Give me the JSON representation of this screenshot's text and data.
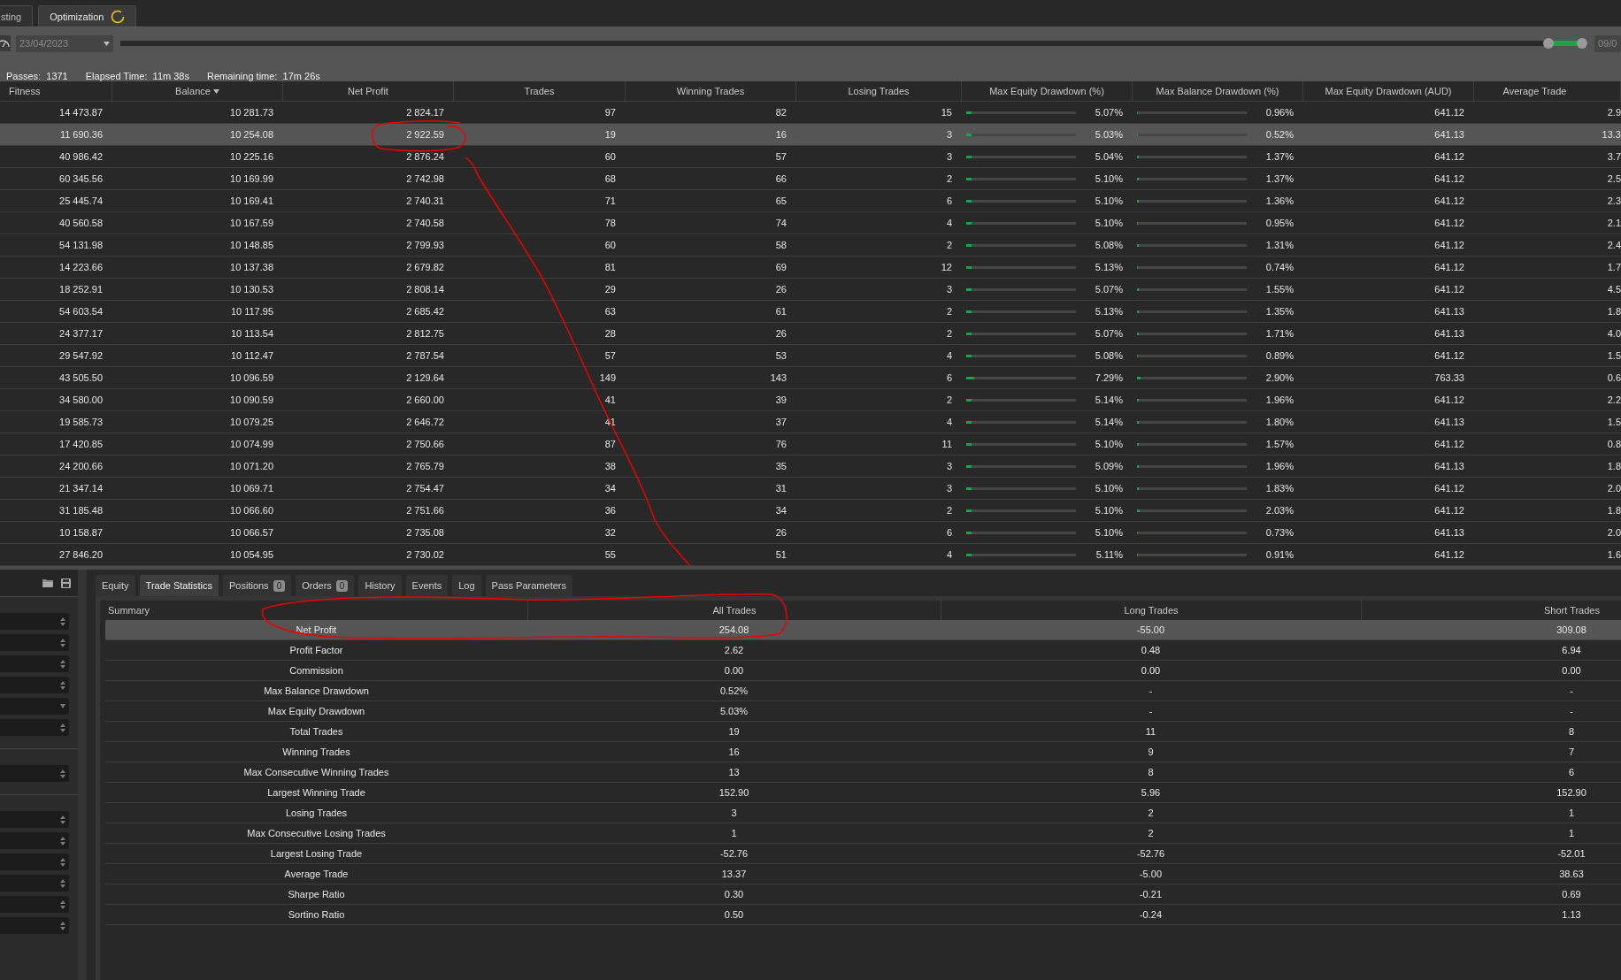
{
  "tabs": [
    {
      "label": "sting",
      "selected": false,
      "spinner": false
    },
    {
      "label": "Optimization",
      "selected": true,
      "spinner": true
    }
  ],
  "toolbar": {
    "start_date": "23/04/2023",
    "end_date": "09/0",
    "range": {
      "from": {
        "level": 0.977
      },
      "to": {
        "level": 1.0
      }
    }
  },
  "status": [
    {
      "label": "Passes:",
      "value": "1371"
    },
    {
      "label": "Elapsed Time:",
      "value": "11m 38s"
    },
    {
      "label": "Remaining time:",
      "value": "17m 26s"
    }
  ],
  "results": {
    "columns": [
      {
        "label": "Fitness",
        "kind": "text",
        "sorted": false
      },
      {
        "label": "Balance",
        "kind": "text",
        "sorted": true
      },
      {
        "label": "Net Profit",
        "kind": "text",
        "sorted": false
      },
      {
        "label": "Trades",
        "kind": "text",
        "sorted": false
      },
      {
        "label": "Winning Trades",
        "kind": "text",
        "sorted": false
      },
      {
        "label": "Losing Trades",
        "kind": "text",
        "sorted": false
      },
      {
        "label": "Max Equity Drawdown (%)",
        "kind": "bar",
        "sorted": false
      },
      {
        "label": "Max Balance Drawdown (%)",
        "kind": "bar",
        "sorted": false
      },
      {
        "label": "Max Equity Drawdown (AUD)",
        "kind": "text",
        "sorted": false
      },
      {
        "label": "Average Trade",
        "kind": "text",
        "sorted": false
      }
    ],
    "rows": [
      {
        "selected": false,
        "cells": [
          {
            "text": "14 473.87"
          },
          {
            "text": "10 281.73"
          },
          {
            "text": "2 824.17"
          },
          {
            "text": "97"
          },
          {
            "text": "82"
          },
          {
            "text": "15"
          },
          {
            "text": "5.07%",
            "level": 0.0507
          },
          {
            "text": "0.96%",
            "level": 0.0096
          },
          {
            "text": "641.12"
          },
          {
            "text": "2.9"
          }
        ]
      },
      {
        "selected": true,
        "cells": [
          {
            "text": "11 690.36"
          },
          {
            "text": "10 254.08"
          },
          {
            "text": "2 922.59"
          },
          {
            "text": "19"
          },
          {
            "text": "16"
          },
          {
            "text": "3"
          },
          {
            "text": "5.03%",
            "level": 0.0503
          },
          {
            "text": "0.52%",
            "level": 0.0052
          },
          {
            "text": "641.13"
          },
          {
            "text": "13.3"
          }
        ]
      },
      {
        "selected": false,
        "cells": [
          {
            "text": "40 986.42"
          },
          {
            "text": "10 225.16"
          },
          {
            "text": "2 876.24"
          },
          {
            "text": "60"
          },
          {
            "text": "57"
          },
          {
            "text": "3"
          },
          {
            "text": "5.04%",
            "level": 0.0504
          },
          {
            "text": "1.37%",
            "level": 0.0137
          },
          {
            "text": "641.12"
          },
          {
            "text": "3.7"
          }
        ]
      },
      {
        "selected": false,
        "cells": [
          {
            "text": "60 345.56"
          },
          {
            "text": "10 169.99"
          },
          {
            "text": "2 742.98"
          },
          {
            "text": "68"
          },
          {
            "text": "66"
          },
          {
            "text": "2"
          },
          {
            "text": "5.10%",
            "level": 0.051
          },
          {
            "text": "1.37%",
            "level": 0.0137
          },
          {
            "text": "641.12"
          },
          {
            "text": "2.5"
          }
        ]
      },
      {
        "selected": false,
        "cells": [
          {
            "text": "25 445.74"
          },
          {
            "text": "10 169.41"
          },
          {
            "text": "2 740.31"
          },
          {
            "text": "71"
          },
          {
            "text": "65"
          },
          {
            "text": "6"
          },
          {
            "text": "5.10%",
            "level": 0.051
          },
          {
            "text": "1.36%",
            "level": 0.0136
          },
          {
            "text": "641.12"
          },
          {
            "text": "2.3"
          }
        ]
      },
      {
        "selected": false,
        "cells": [
          {
            "text": "40 560.58"
          },
          {
            "text": "10 167.59"
          },
          {
            "text": "2 740.58"
          },
          {
            "text": "78"
          },
          {
            "text": "74"
          },
          {
            "text": "4"
          },
          {
            "text": "5.10%",
            "level": 0.051
          },
          {
            "text": "0.95%",
            "level": 0.0095
          },
          {
            "text": "641.12"
          },
          {
            "text": "2.1"
          }
        ]
      },
      {
        "selected": false,
        "cells": [
          {
            "text": "54 131.98"
          },
          {
            "text": "10 148.85"
          },
          {
            "text": "2 799.93"
          },
          {
            "text": "60"
          },
          {
            "text": "58"
          },
          {
            "text": "2"
          },
          {
            "text": "5.08%",
            "level": 0.0508
          },
          {
            "text": "1.31%",
            "level": 0.0131
          },
          {
            "text": "641.12"
          },
          {
            "text": "2.4"
          }
        ]
      },
      {
        "selected": false,
        "cells": [
          {
            "text": "14 223.66"
          },
          {
            "text": "10 137.38"
          },
          {
            "text": "2 679.82"
          },
          {
            "text": "81"
          },
          {
            "text": "69"
          },
          {
            "text": "12"
          },
          {
            "text": "5.13%",
            "level": 0.0513
          },
          {
            "text": "0.74%",
            "level": 0.0074
          },
          {
            "text": "641.12"
          },
          {
            "text": "1.7"
          }
        ]
      },
      {
        "selected": false,
        "cells": [
          {
            "text": "18 252.91"
          },
          {
            "text": "10 130.53"
          },
          {
            "text": "2 808.14"
          },
          {
            "text": "29"
          },
          {
            "text": "26"
          },
          {
            "text": "3"
          },
          {
            "text": "5.07%",
            "level": 0.0507
          },
          {
            "text": "1.55%",
            "level": 0.0155
          },
          {
            "text": "641.12"
          },
          {
            "text": "4.5"
          }
        ]
      },
      {
        "selected": false,
        "cells": [
          {
            "text": "54 603.54"
          },
          {
            "text": "10 117.95"
          },
          {
            "text": "2 685.42"
          },
          {
            "text": "63"
          },
          {
            "text": "61"
          },
          {
            "text": "2"
          },
          {
            "text": "5.13%",
            "level": 0.0513
          },
          {
            "text": "1.35%",
            "level": 0.0135
          },
          {
            "text": "641.13"
          },
          {
            "text": "1.8"
          }
        ]
      },
      {
        "selected": false,
        "cells": [
          {
            "text": "24 377.17"
          },
          {
            "text": "10 113.54"
          },
          {
            "text": "2 812.75"
          },
          {
            "text": "28"
          },
          {
            "text": "26"
          },
          {
            "text": "2"
          },
          {
            "text": "5.07%",
            "level": 0.0507
          },
          {
            "text": "1.71%",
            "level": 0.0171
          },
          {
            "text": "641.13"
          },
          {
            "text": "4.0"
          }
        ]
      },
      {
        "selected": false,
        "cells": [
          {
            "text": "29 547.92"
          },
          {
            "text": "10 112.47"
          },
          {
            "text": "2 787.54"
          },
          {
            "text": "57"
          },
          {
            "text": "53"
          },
          {
            "text": "4"
          },
          {
            "text": "5.08%",
            "level": 0.0508
          },
          {
            "text": "0.89%",
            "level": 0.0089
          },
          {
            "text": "641.12"
          },
          {
            "text": "1.5"
          }
        ]
      },
      {
        "selected": false,
        "cells": [
          {
            "text": "43 505.50"
          },
          {
            "text": "10 096.59"
          },
          {
            "text": "2 129.64"
          },
          {
            "text": "149"
          },
          {
            "text": "143"
          },
          {
            "text": "6"
          },
          {
            "text": "7.29%",
            "level": 0.0729
          },
          {
            "text": "2.90%",
            "level": 0.029
          },
          {
            "text": "763.33"
          },
          {
            "text": "0.6"
          }
        ]
      },
      {
        "selected": false,
        "cells": [
          {
            "text": "34 580.00"
          },
          {
            "text": "10 090.59"
          },
          {
            "text": "2 660.00"
          },
          {
            "text": "41"
          },
          {
            "text": "39"
          },
          {
            "text": "2"
          },
          {
            "text": "5.14%",
            "level": 0.0514
          },
          {
            "text": "1.96%",
            "level": 0.0196
          },
          {
            "text": "641.12"
          },
          {
            "text": "2.2"
          }
        ]
      },
      {
        "selected": false,
        "cells": [
          {
            "text": "19 585.73"
          },
          {
            "text": "10 079.25"
          },
          {
            "text": "2 646.72"
          },
          {
            "text": "41"
          },
          {
            "text": "37"
          },
          {
            "text": "4"
          },
          {
            "text": "5.14%",
            "level": 0.0514
          },
          {
            "text": "1.80%",
            "level": 0.018
          },
          {
            "text": "641.13"
          },
          {
            "text": "1.5"
          }
        ]
      },
      {
        "selected": false,
        "cells": [
          {
            "text": "17 420.85"
          },
          {
            "text": "10 074.99"
          },
          {
            "text": "2 750.66"
          },
          {
            "text": "87"
          },
          {
            "text": "76"
          },
          {
            "text": "11"
          },
          {
            "text": "5.10%",
            "level": 0.051
          },
          {
            "text": "1.57%",
            "level": 0.0157
          },
          {
            "text": "641.12"
          },
          {
            "text": "0.8"
          }
        ]
      },
      {
        "selected": false,
        "cells": [
          {
            "text": "24 200.66"
          },
          {
            "text": "10 071.20"
          },
          {
            "text": "2 765.79"
          },
          {
            "text": "38"
          },
          {
            "text": "35"
          },
          {
            "text": "3"
          },
          {
            "text": "5.09%",
            "level": 0.0509
          },
          {
            "text": "1.96%",
            "level": 0.0196
          },
          {
            "text": "641.13"
          },
          {
            "text": "1.8"
          }
        ]
      },
      {
        "selected": false,
        "cells": [
          {
            "text": "21 347.14"
          },
          {
            "text": "10 069.71"
          },
          {
            "text": "2 754.47"
          },
          {
            "text": "34"
          },
          {
            "text": "31"
          },
          {
            "text": "3"
          },
          {
            "text": "5.10%",
            "level": 0.051
          },
          {
            "text": "1.83%",
            "level": 0.0183
          },
          {
            "text": "641.12"
          },
          {
            "text": "2.0"
          }
        ]
      },
      {
        "selected": false,
        "cells": [
          {
            "text": "31 185.48"
          },
          {
            "text": "10 066.60"
          },
          {
            "text": "2 751.66"
          },
          {
            "text": "36"
          },
          {
            "text": "34"
          },
          {
            "text": "2"
          },
          {
            "text": "5.10%",
            "level": 0.051
          },
          {
            "text": "2.03%",
            "level": 0.0203
          },
          {
            "text": "641.12"
          },
          {
            "text": "1.8"
          }
        ]
      },
      {
        "selected": false,
        "cells": [
          {
            "text": "10 158.87"
          },
          {
            "text": "10 066.57"
          },
          {
            "text": "2 735.08"
          },
          {
            "text": "32"
          },
          {
            "text": "26"
          },
          {
            "text": "6"
          },
          {
            "text": "5.10%",
            "level": 0.051
          },
          {
            "text": "0.73%",
            "level": 0.0073
          },
          {
            "text": "641.13"
          },
          {
            "text": "2.0"
          }
        ]
      },
      {
        "selected": false,
        "cells": [
          {
            "text": "27 846.20"
          },
          {
            "text": "10 054.95"
          },
          {
            "text": "2 730.02"
          },
          {
            "text": "55"
          },
          {
            "text": "51"
          },
          {
            "text": "4"
          },
          {
            "text": "5.11%",
            "level": 0.0511
          },
          {
            "text": "0.91%",
            "level": 0.0091
          },
          {
            "text": "641.12"
          },
          {
            "text": "1.6"
          }
        ]
      }
    ]
  },
  "parameter_groups": [
    {
      "fields": [
        {
          "kind": "spin"
        },
        {
          "kind": "spin"
        },
        {
          "kind": "spin"
        },
        {
          "kind": "spin"
        },
        {
          "kind": "dropdown"
        },
        {
          "kind": "spin"
        }
      ]
    },
    {
      "fields": [
        {
          "kind": "spin"
        }
      ]
    },
    {
      "fields": [
        {
          "kind": "spin"
        },
        {
          "kind": "spin"
        },
        {
          "kind": "spin"
        },
        {
          "kind": "spin"
        },
        {
          "kind": "spin"
        },
        {
          "kind": "spin"
        }
      ]
    }
  ],
  "bottom_tabs": [
    {
      "label": "Equity",
      "selected": false
    },
    {
      "label": "Trade Statistics",
      "selected": true
    },
    {
      "label": "Positions",
      "selected": false,
      "badge": "0"
    },
    {
      "label": "Orders",
      "selected": false,
      "badge": "0"
    },
    {
      "label": "History",
      "selected": false
    },
    {
      "label": "Events",
      "selected": false
    },
    {
      "label": "Log",
      "selected": false
    },
    {
      "label": "Pass Parameters",
      "selected": false
    }
  ],
  "statistics": {
    "columns": [
      "Summary",
      "All Trades",
      "Long Trades",
      "Short Trades"
    ],
    "rows": [
      {
        "label": "Net Profit",
        "all": "254.08",
        "long": "-55.00",
        "short": "309.08",
        "selected": true
      },
      {
        "label": "Profit Factor",
        "all": "2.62",
        "long": "0.48",
        "short": "6.94",
        "selected": false
      },
      {
        "label": "Commission",
        "all": "0.00",
        "long": "0.00",
        "short": "0.00",
        "selected": false
      },
      {
        "label": "Max Balance Drawdown",
        "all": "0.52%",
        "long": "-",
        "short": "-",
        "selected": false
      },
      {
        "label": "Max Equity Drawdown",
        "all": "5.03%",
        "long": "-",
        "short": "-",
        "selected": false
      },
      {
        "label": "Total Trades",
        "all": "19",
        "long": "11",
        "short": "8",
        "selected": false
      },
      {
        "label": "Winning Trades",
        "all": "16",
        "long": "9",
        "short": "7",
        "selected": false
      },
      {
        "label": "Max Consecutive Winning Trades",
        "all": "13",
        "long": "8",
        "short": "6",
        "selected": false
      },
      {
        "label": "Largest Winning Trade",
        "all": "152.90",
        "long": "5.96",
        "short": "152.90",
        "selected": false
      },
      {
        "label": "Losing Trades",
        "all": "3",
        "long": "2",
        "short": "1",
        "selected": false
      },
      {
        "label": "Max Consecutive Losing Trades",
        "all": "1",
        "long": "2",
        "short": "1",
        "selected": false
      },
      {
        "label": "Largest Losing Trade",
        "all": "-52.76",
        "long": "-52.76",
        "short": "-52.01",
        "selected": false
      },
      {
        "label": "Average Trade",
        "all": "13.37",
        "long": "-5.00",
        "short": "38.63",
        "selected": false
      },
      {
        "label": "Sharpe Ratio",
        "all": "0.30",
        "long": "-0.21",
        "short": "0.69",
        "selected": false
      },
      {
        "label": "Sortino Ratio",
        "all": "0.50",
        "long": "-0.24",
        "short": "1.13",
        "selected": false
      }
    ]
  },
  "annotations": [
    {
      "kind": "circle"
    },
    {
      "kind": "stroke"
    },
    {
      "kind": "ellipse"
    }
  ]
}
